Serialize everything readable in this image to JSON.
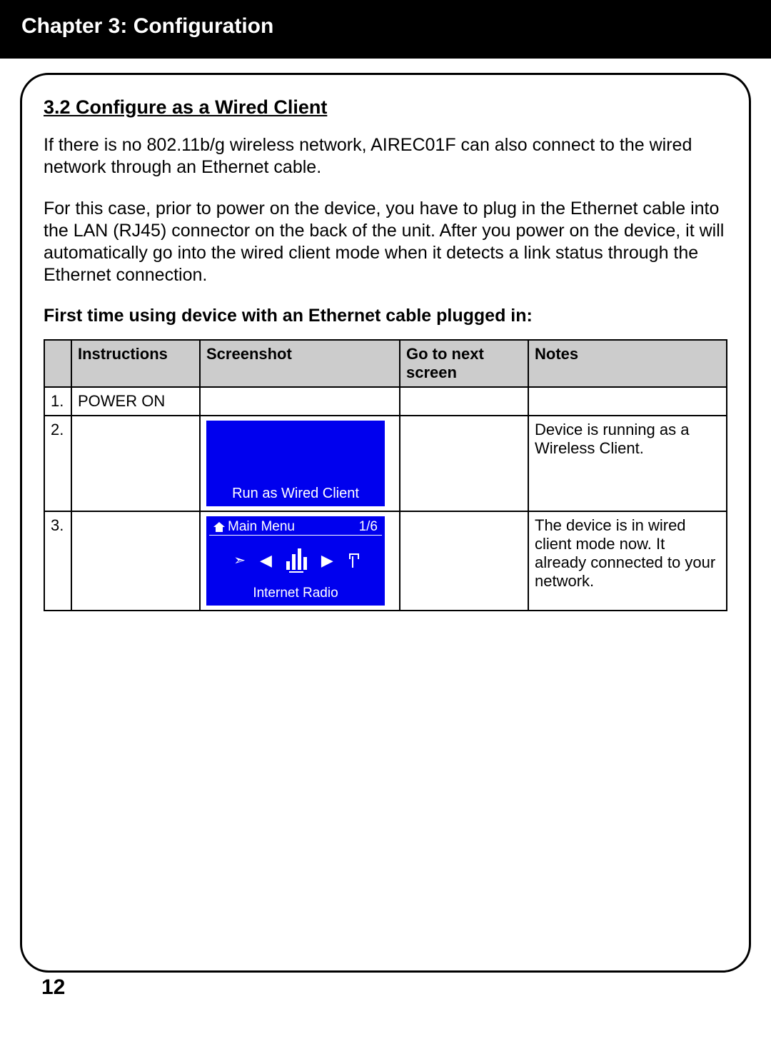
{
  "header": {
    "title": "Chapter 3: Configuration"
  },
  "section": {
    "title": "3.2 Configure as a Wired Client",
    "para1": "If there is no 802.11b/g wireless network, AIREC01F can also connect to the wired network through an Ethernet cable.",
    "para2": "For this case, prior to power on the device, you have to plug in the Ethernet cable into the LAN (RJ45) connector on the back of the unit. After you power on the device, it will automatically go into the wired client mode when it detects a link status through the Ethernet connection.",
    "subhead": "First time using device with an Ethernet cable plugged in:"
  },
  "table": {
    "headers": {
      "c1": "Instructions",
      "c2": "Screenshot",
      "c3": "Go to next screen",
      "c4": "Notes"
    },
    "rows": [
      {
        "num": "1.",
        "instructions": "POWER ON",
        "screenshot": null,
        "goto": "",
        "notes": ""
      },
      {
        "num": "2.",
        "instructions": "",
        "screenshot": {
          "type": "simple",
          "bottom_text": "Run as Wired Client"
        },
        "goto": "",
        "notes": "Device is running as a Wireless Client."
      },
      {
        "num": "3.",
        "instructions": "",
        "screenshot": {
          "type": "menu",
          "top_left": "Main Menu",
          "top_right": "1/6",
          "bottom_text": "Internet Radio"
        },
        "goto": "",
        "notes": "The device is in wired client mode now. It already connected to your network."
      }
    ]
  },
  "page_number": "12"
}
